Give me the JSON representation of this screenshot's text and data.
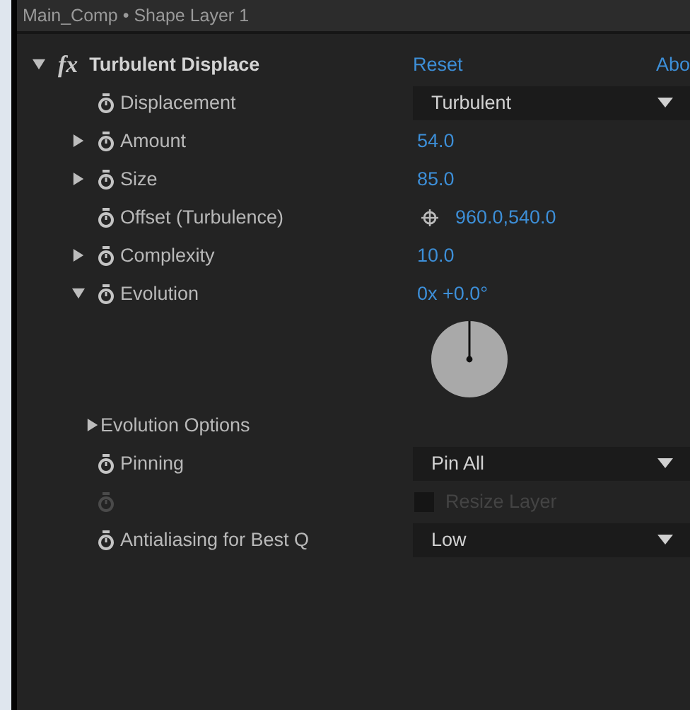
{
  "panel": {
    "title": "Main_Comp • Shape Layer 1"
  },
  "effect": {
    "fx": "fx",
    "name": "Turbulent Displace",
    "expanded": true,
    "reset": "Reset",
    "about": "Abo"
  },
  "properties": [
    {
      "kind": "popup",
      "label": "Displacement",
      "value": "Turbulent"
    },
    {
      "kind": "number",
      "label": "Amount",
      "value": "54.0",
      "expanded": false
    },
    {
      "kind": "number",
      "label": "Size",
      "value": "85.0",
      "expanded": false
    },
    {
      "kind": "point",
      "label": "Offset (Turbulence)",
      "value": "960.0,540.0"
    },
    {
      "kind": "number",
      "label": "Complexity",
      "value": "10.0",
      "expanded": false
    },
    {
      "kind": "angle",
      "label": "Evolution",
      "value": "0x +0.0°",
      "expanded": true
    },
    {
      "kind": "group",
      "label": "Evolution Options",
      "expanded": false
    },
    {
      "kind": "popup",
      "label": "Pinning",
      "value": "Pin All"
    },
    {
      "kind": "checkbox",
      "label": "Resize Layer",
      "checked": false,
      "disabled": true
    },
    {
      "kind": "popup",
      "label": "Antialiasing for Best Q",
      "value": "Low"
    }
  ]
}
